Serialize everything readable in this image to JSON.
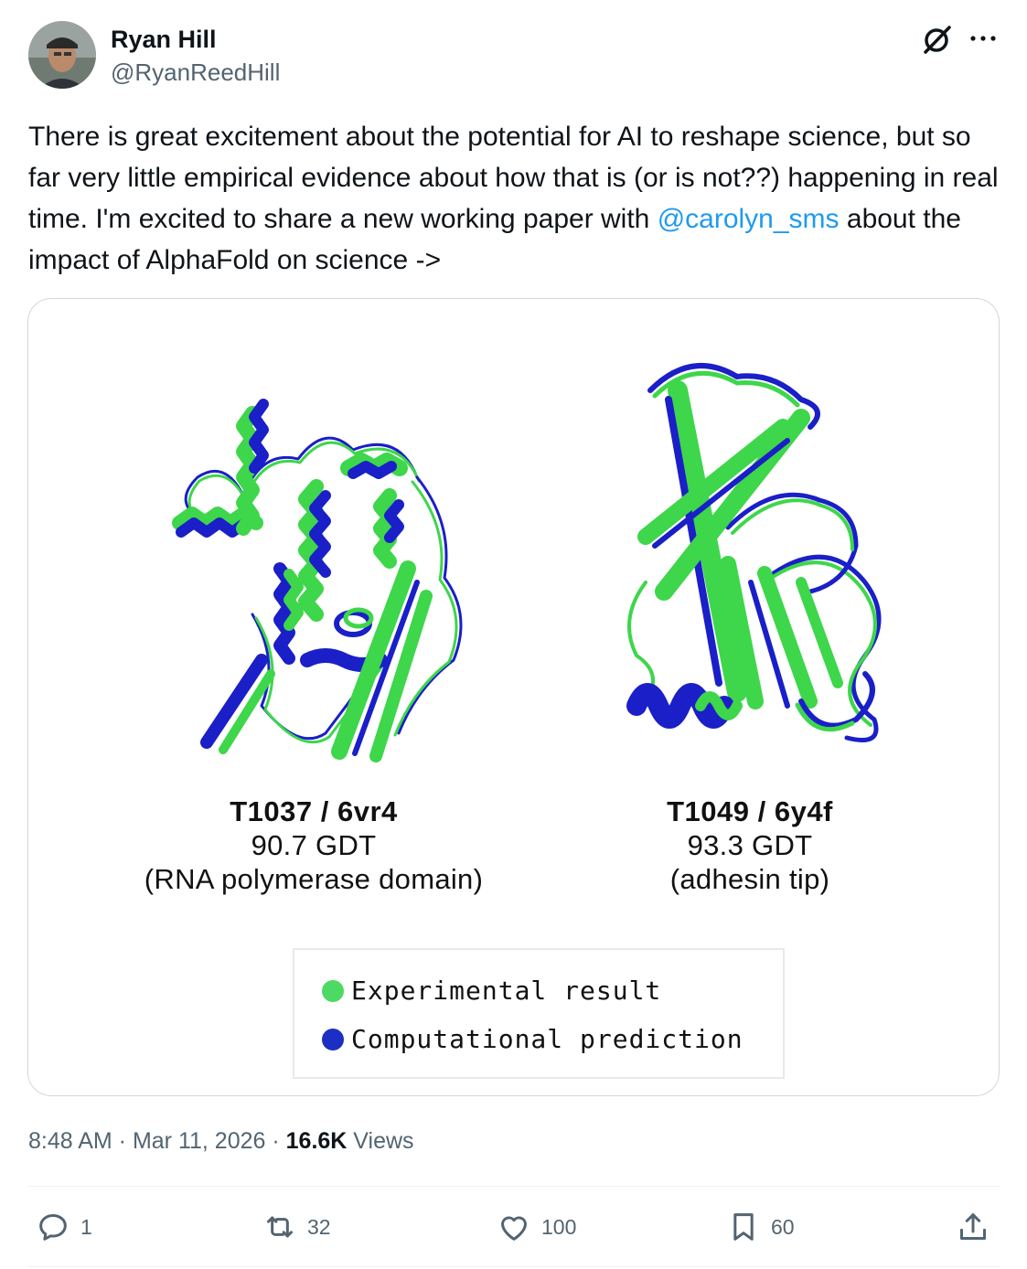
{
  "author": {
    "name": "Ryan Hill",
    "handle": "@RyanReedHill"
  },
  "tweet": {
    "text_before": "There is great excitement about the potential for AI to reshape science, but so far very little empirical evidence about how that is (or is not??) happening in real time. I'm excited to share a new working paper with ",
    "mention": "@carolyn_sms",
    "text_after": " about the impact of AlphaFold on science ->"
  },
  "media": {
    "left": {
      "title": "T1037 / 6vr4",
      "score": "90.7 GDT",
      "desc": "(RNA polymerase domain)"
    },
    "right": {
      "title": "T1049 / 6y4f",
      "score": "93.3 GDT",
      "desc": "(adhesin tip)"
    },
    "legend": [
      {
        "label": "Experimental result",
        "color": "#4cd964"
      },
      {
        "label": "Computational prediction",
        "color": "#1c2fc4"
      }
    ],
    "colors": {
      "experimental": "#3ed64a",
      "prediction": "#1a1fc8"
    }
  },
  "meta": {
    "time": "8:48 AM",
    "sep1": " · ",
    "date": "Mar 11, 2026",
    "sep2": " · ",
    "views_count": "16.6K",
    "views_label": " Views"
  },
  "actions": {
    "replies": "1",
    "reposts": "32",
    "likes": "100",
    "bookmarks": "60"
  },
  "icons": [
    "grok-icon",
    "more-icon",
    "reply-icon",
    "repost-icon",
    "like-icon",
    "bookmark-icon",
    "share-icon"
  ]
}
